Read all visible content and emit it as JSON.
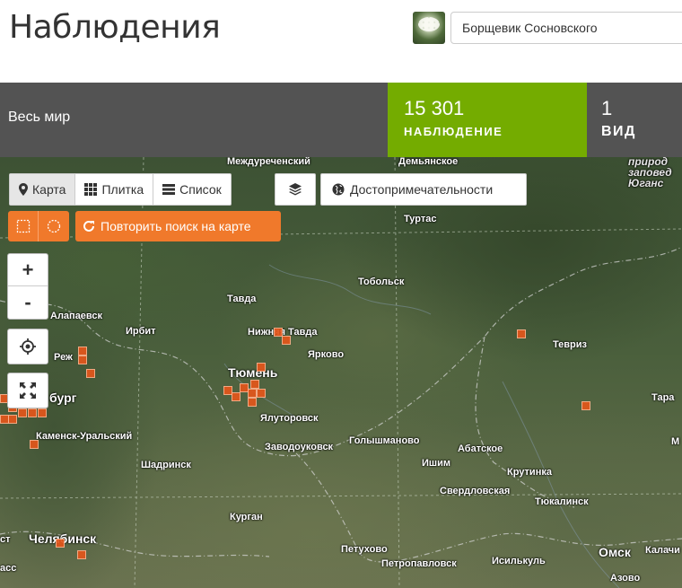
{
  "header": {
    "title": "Наблюдения",
    "taxon_thumb": "hogweed-photo",
    "taxon_value": "Борщевик Сосновского"
  },
  "stats": {
    "place": "Весь мир",
    "observations_count": "15 301",
    "observations_label": "НАБЛЮДЕНИЕ",
    "species_count": "1",
    "species_label": "ВИД",
    "accent_color": "#74ac00",
    "bar_color": "#535353"
  },
  "map": {
    "view_tabs": [
      {
        "label": "Карта",
        "icon": "map-marker-icon",
        "active": true
      },
      {
        "label": "Плитка",
        "icon": "grid-icon",
        "active": false
      },
      {
        "label": "Список",
        "icon": "list-icon",
        "active": false
      }
    ],
    "layers_icon": "layers-icon",
    "landmarks_label": "Достопримечательности",
    "landmarks_icon": "globe-icon",
    "redo_search_label": "Повторить поиск на карте",
    "controls_color": "#f0792b",
    "zoom_in": "+",
    "zoom_out": "-",
    "observation_cell_color": "#e4561b",
    "cities": {
      "mezhdurechensky": "Междуреченский",
      "demyanskoe": "Демьянское",
      "zapoved": "природ заповед Юганс",
      "turtas": "Туртас",
      "tobolsk": "Тобольск",
      "tavda": "Тавда",
      "alapaevsk": "Алапаевск",
      "irbit": "Ирбит",
      "nizhnyaya_tavda": "Нижняя Тавда",
      "tevriz": "Тевриз",
      "yarkovo": "Ярково",
      "rezh": "Реж",
      "tyumen": "Тюмень",
      "ekaterinburg": "бург",
      "tara": "Тара",
      "yalutorovsk": "Ялуторовск",
      "kamensk": "Каменск-Уральский",
      "zavodoukovsk": "Заводоуковск",
      "golyshmanovo": "Голышманово",
      "abatskoe": "Абатское",
      "m_edge": "М",
      "shadrinsk": "Шадринск",
      "ishim": "Ишим",
      "krutinka": "Крутинка",
      "sverdlovskaya": "Свердловская",
      "tyukalinsk": "Тюкалинск",
      "kurgan": "Курган",
      "chelyabinsk": "Челябинск",
      "st_edge": "ст",
      "petukhovo": "Петухово",
      "omsk": "Омск",
      "kalachinsk": "Калачи",
      "petropavlovsk": "Петропавловск",
      "isilkul": "Исилькуль",
      "assa": "асс",
      "azovo": "Азово"
    }
  }
}
